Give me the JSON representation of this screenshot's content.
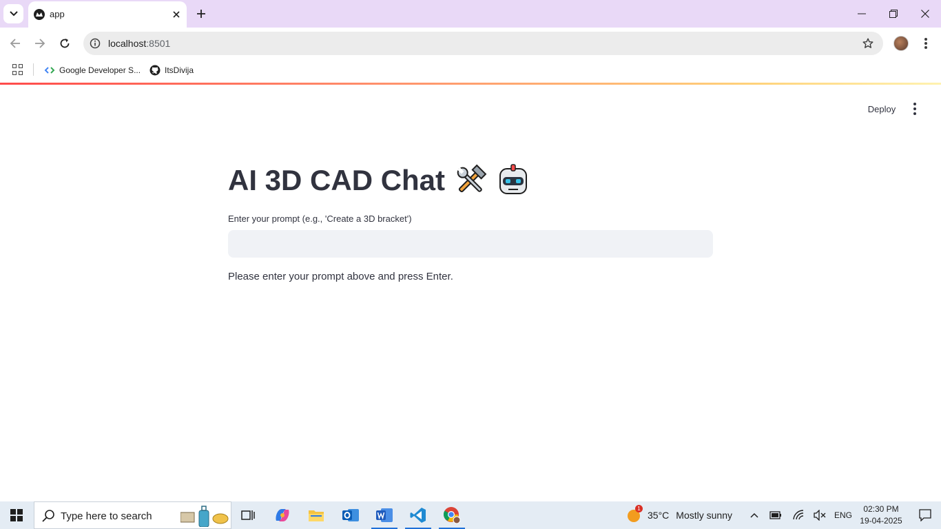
{
  "browser": {
    "tab_title": "app",
    "url_host": "localhost",
    "url_port": ":8501",
    "bookmarks": [
      {
        "label": "Google Developer S..."
      },
      {
        "label": "ItsDivija"
      }
    ]
  },
  "app": {
    "deploy_label": "Deploy",
    "title": "AI 3D CAD Chat",
    "prompt_label": "Enter your prompt (e.g., 'Create a 3D bracket')",
    "prompt_value": "",
    "info_text": "Please enter your prompt above and press Enter."
  },
  "taskbar": {
    "search_placeholder": "Type here to search",
    "weather_badge": "1",
    "weather_temp": "35°C",
    "weather_text": "Mostly sunny",
    "language": "ENG",
    "time": "02:30 PM",
    "date": "19-04-2025"
  },
  "colors": {
    "tabbar": "#e9d9f7",
    "accent": "#ff4b4b",
    "text": "#31333f",
    "input_bg": "#f0f2f6"
  }
}
